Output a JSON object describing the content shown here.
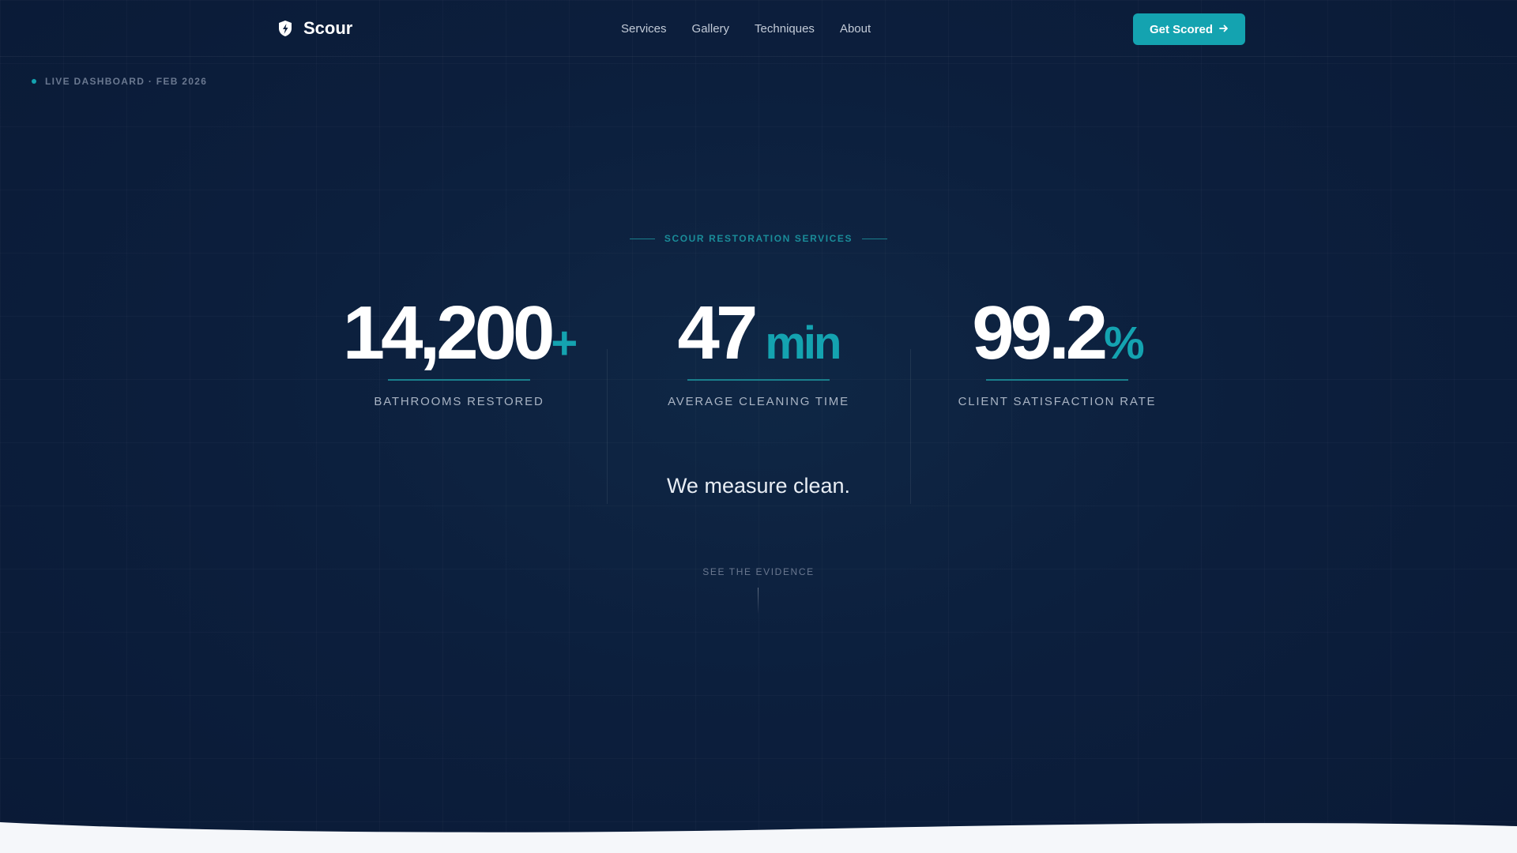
{
  "colors": {
    "background": "#0c1f3d",
    "accent": "#14a3b0",
    "footer": "#f5f7fa"
  },
  "nav": {
    "brand": "Scour",
    "brand_icon": "shield-icon",
    "links": [
      "Services",
      "Gallery",
      "Techniques",
      "About"
    ],
    "cta_label": "Get Scored",
    "cta_icon": "arrow-right-icon"
  },
  "badge": {
    "text": "LIVE DASHBOARD · FEB 2026"
  },
  "hero": {
    "eyebrow": "SCOUR RESTORATION SERVICES",
    "stats": [
      {
        "value": "14,200",
        "suffix": "+",
        "label": "BATHROOMS RESTORED"
      },
      {
        "value": "47",
        "suffix": "min",
        "label": "AVERAGE CLEANING TIME"
      },
      {
        "value": "99.2",
        "suffix": "%",
        "label": "CLIENT SATISFACTION RATE"
      }
    ],
    "tagline": "We measure clean.",
    "scroll_cue": "SEE THE EVIDENCE"
  }
}
